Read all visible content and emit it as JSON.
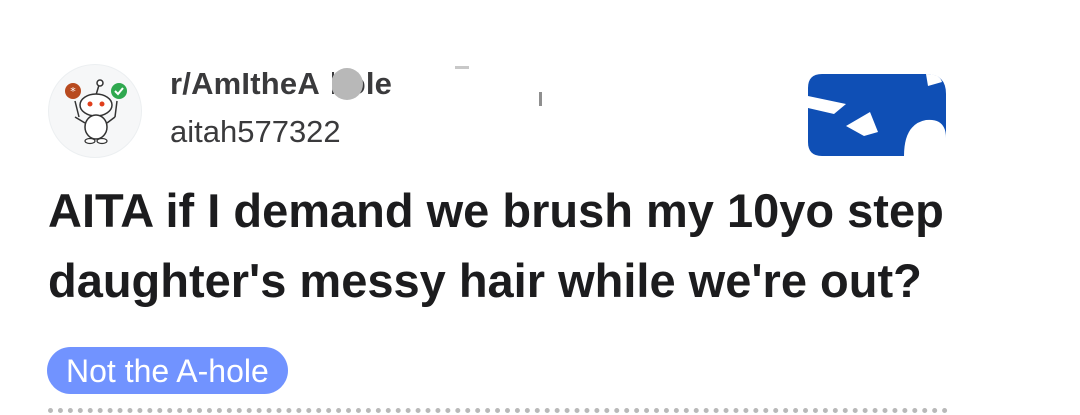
{
  "header": {
    "subreddit": "r/AmItheA  hole",
    "username": "aitah577322",
    "avatar_icon": "snoo-mascot-icon",
    "join_icon": "join-badge-icon",
    "join_color": "#0f4fb5"
  },
  "post": {
    "title": "AITA if I demand we brush my 10yo step daughter's messy hair while we're out?",
    "flair": "Not the A-hole",
    "flair_color": "#7193ff"
  }
}
